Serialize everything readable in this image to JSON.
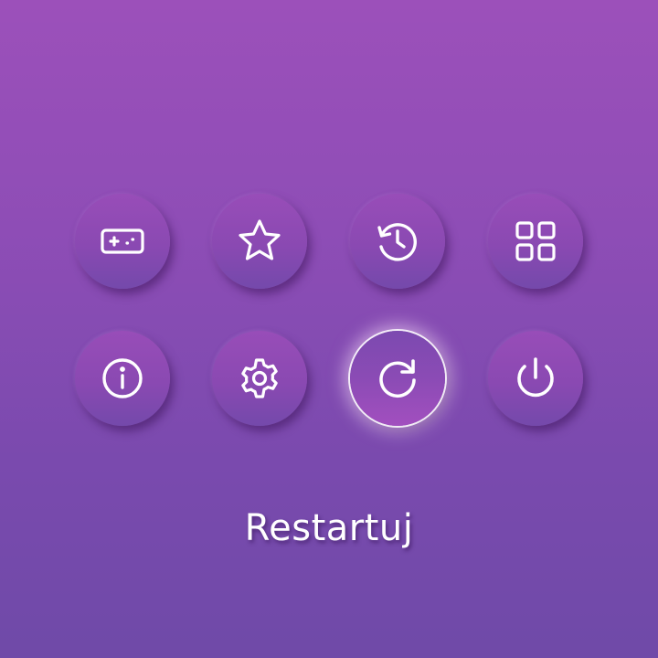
{
  "menu": {
    "selected_label": "Restartuj",
    "buttons": [
      {
        "icon": "gamepad-icon",
        "selected": false
      },
      {
        "icon": "star-icon",
        "selected": false
      },
      {
        "icon": "history-icon",
        "selected": false
      },
      {
        "icon": "apps-grid-icon",
        "selected": false
      },
      {
        "icon": "info-icon",
        "selected": false
      },
      {
        "icon": "settings-gear-icon",
        "selected": false
      },
      {
        "icon": "restart-icon",
        "selected": true
      },
      {
        "icon": "power-icon",
        "selected": false
      }
    ]
  },
  "colors": {
    "background_top": "#9c50ba",
    "background_bottom": "#6f4aa8",
    "icon_stroke": "#ffffff",
    "selected_glow": "#ffe6ff"
  }
}
